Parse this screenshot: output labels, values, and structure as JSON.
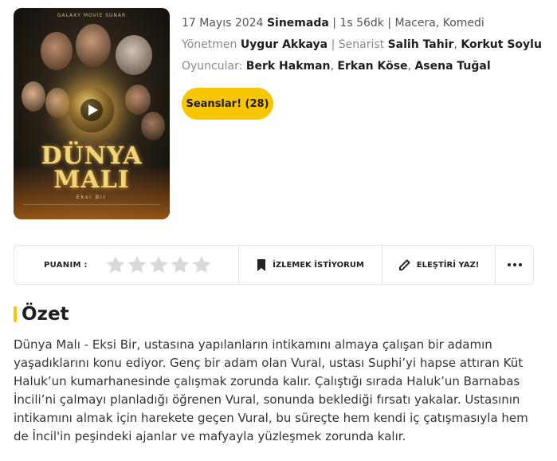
{
  "poster": {
    "brand": "GALAXY MOVIE SUNAR",
    "title_line1": "DÜNYA",
    "title_line2": "MALI",
    "subtitle": "Eksi Bir"
  },
  "movie": {
    "release_date": "17 Mayıs 2024",
    "status": "Sinemada",
    "duration": "1s 56dk",
    "genres": "Macera, Komedi",
    "director_label": "Yönetmen",
    "director": "Uygur Akkaya",
    "writer_label": "Senarist",
    "writers": [
      "Salih Tahir",
      "Korkut Soylu"
    ],
    "cast_label": "Oyuncular:",
    "cast": [
      "Berk Hakman",
      "Erkan Köse",
      "Asena Tuğal"
    ]
  },
  "buttons": {
    "showtimes": "Seanslar! (28)"
  },
  "action_bar": {
    "rating_label": "PUANIM :",
    "rating_value": 0,
    "rating_max": 5,
    "watchlist_label": "İZLEMEK İSTİYORUM",
    "review_label": "ELEŞTİRİ YAZ!"
  },
  "summary": {
    "heading": "Özet",
    "text": "Dünya Malı - Eksi Bir, ustasına yapılanların intikamını almaya çalışan bir adamın yaşadıklarını konu ediyor. Genç bir adam olan Vural, ustası Suphi’yi hapse attıran Küt Haluk’un kumarhanesinde çalışmak zorunda kalır. Çalıştığı sırada Haluk’un Barnabas İncili’ni çalmayı planladığı öğrenen Vural, sonunda beklediği fırsatı yakalar. Ustasının intikamını almak için harekete geçen Vural, bu süreçte hem kendi iç çatışmasıyla hem de İncil'in peşindeki ajanlar ve mafyayla yüzleşmek zorunda kalır."
  },
  "colors": {
    "accent": "#f7c600",
    "star_empty": "#d9d9d9"
  }
}
